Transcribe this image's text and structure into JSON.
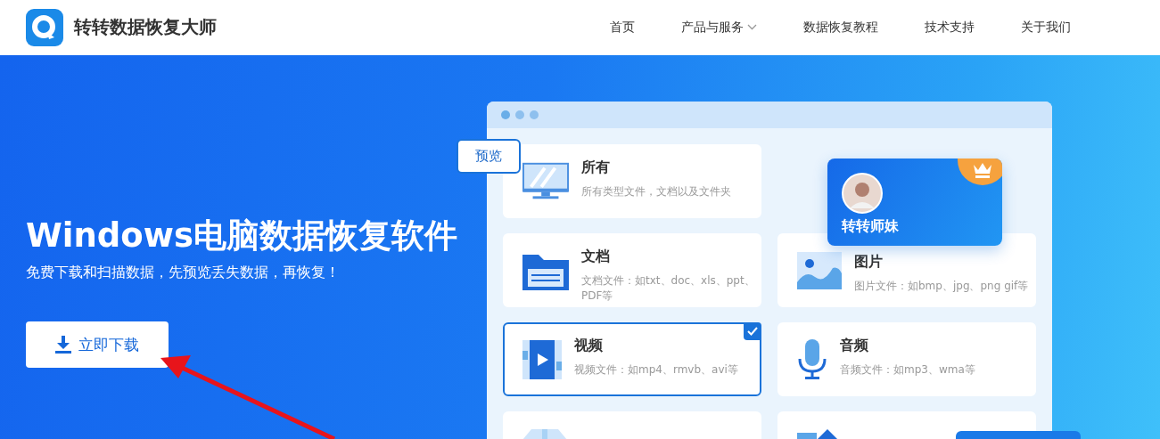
{
  "header": {
    "brand": "转转数据恢复大师",
    "nav": [
      {
        "label": "首页",
        "kind": "link"
      },
      {
        "label": "产品与服务",
        "kind": "dropdown"
      },
      {
        "label": "数据恢复教程",
        "kind": "link"
      },
      {
        "label": "技术支持",
        "kind": "link"
      },
      {
        "label": "关于我们",
        "kind": "link"
      }
    ]
  },
  "hero": {
    "title": "Windows电脑数据恢复软件",
    "subtitle": "免费下载和扫描数据，先预览丢失数据，再恢复！",
    "download_button": "立即下载"
  },
  "mockup": {
    "preview_tag": "预览",
    "profile": {
      "name": "转转师妹"
    },
    "cards": [
      {
        "kind": "all",
        "title": "所有",
        "description": "所有类型文件，文档以及文件夹",
        "selected": false
      },
      {
        "kind": "document",
        "title": "文档",
        "description": "文档文件：如txt、doc、xls、ppt、PDF等",
        "selected": false
      },
      {
        "kind": "image",
        "title": "图片",
        "description": "图片文件：如bmp、jpg、png gif等",
        "selected": false
      },
      {
        "kind": "video",
        "title": "视频",
        "description": "视频文件：如mp4、rmvb、avi等",
        "selected": true
      },
      {
        "kind": "audio",
        "title": "音频",
        "description": "音频文件：如mp3、wma等",
        "selected": false
      },
      {
        "kind": "archive",
        "selected": false
      },
      {
        "kind": "other",
        "selected": false
      }
    ]
  }
}
